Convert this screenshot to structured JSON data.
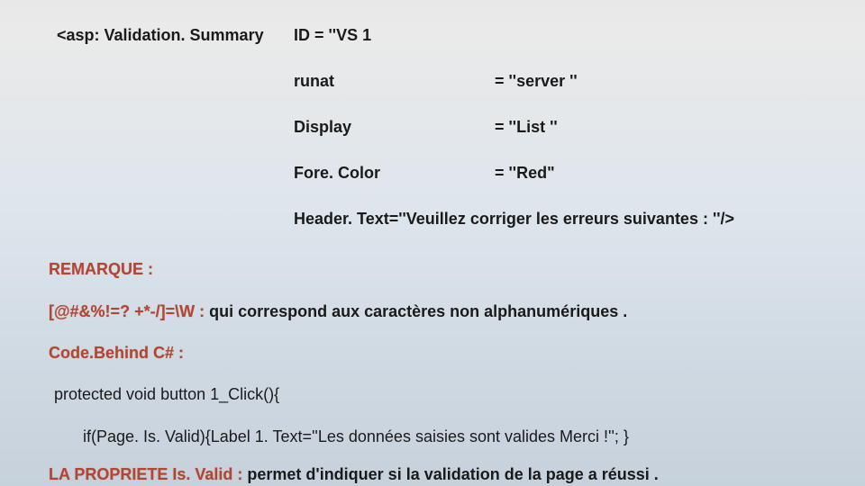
{
  "rows": {
    "r1c1": "<asp: Validation. Summary",
    "r1c2": "ID = ''VS 1",
    "r2c2": "runat",
    "r2c3": "= ''server ''",
    "r3c2": "Display",
    "r3c3": "= ''List ''",
    "r4c2": "Fore. Color",
    "r4c3": "= ''Red\"",
    "r5c2": "Header. Text=''Veuillez corriger les erreurs suivantes  : ''/>"
  },
  "remarque": "REMARQUE :",
  "w": {
    "lead": "[@#&%!=? +*-/]=\\W : ",
    "rest": "qui correspond aux caractères non alphanumériques ."
  },
  "codebehind": "Code.Behind C# :",
  "code1": " protected void button 1_Click(){",
  "code2": "if(Page. Is. Valid){Label 1. Text=''Les données saisies sont valides Merci !''; }",
  "prop": {
    "lead": "LA PROPRIETE Is. Valid : ",
    "rest": "permet d'indiquer si la validation de la page a réussi ."
  }
}
